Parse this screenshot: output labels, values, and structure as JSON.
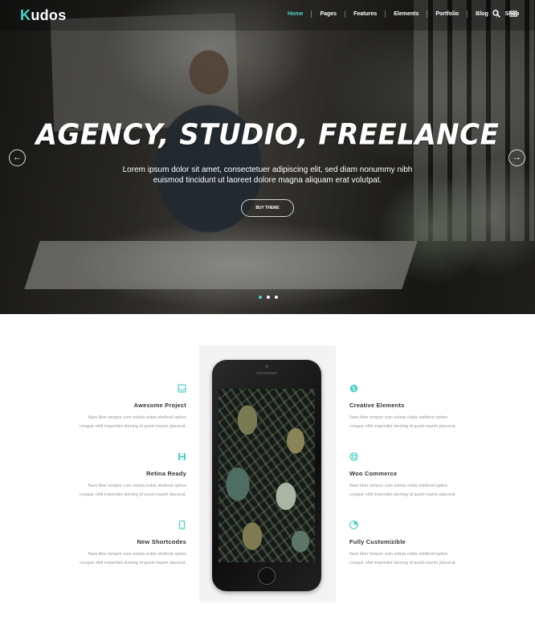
{
  "brand": {
    "logo_initial": "K",
    "logo_rest": "udos",
    "accent_color": "#4fd1c5"
  },
  "nav": {
    "items": [
      "Home",
      "Pages",
      "Features",
      "Elements",
      "Portfolio",
      "Blog",
      "Shop"
    ],
    "active_index": 0,
    "icons": [
      "search-icon",
      "menu-icon"
    ]
  },
  "hero": {
    "title": "AGENCY, STUDIO, FREELANCE",
    "subtitle": "Lorem ipsum dolor sit amet, consectetuer adipiscing elit, sed diam nonummy nibh euismod tincidunt ut laoreet dolore magna aliquam erat volutpat.",
    "button": "BUY THEME",
    "prev_arrow": "←",
    "next_arrow": "→",
    "slides": 3,
    "active_slide": 0
  },
  "features": {
    "left": [
      {
        "icon": "inbox-icon",
        "title": "Awesome Project",
        "text": "Nam liber tempor cum soluta nobis eleifend option congue nihil imperdiet doming id quod mazim placerat."
      },
      {
        "icon": "save-icon",
        "title": "Retina Ready",
        "text": "Nam liber tempor cum soluta nobis eleifend option congue nihil imperdiet doming id quod mazim placerat."
      },
      {
        "icon": "mobile-icon",
        "title": "New Shortcodes",
        "text": "Nam liber tempor cum soluta nobis eleifend option congue nihil imperdiet doming id quod mazim placerat."
      }
    ],
    "right": [
      {
        "icon": "globe-icon",
        "title": "Creative Elements",
        "text": "Nam liber tempor cum soluta nobis eleifend option congue nihil imperdiet doming id quod mazim placerat."
      },
      {
        "icon": "lifebuoy-icon",
        "title": "Woo Commerce",
        "text": "Nam liber tempor cum soluta nobis eleifend option congue nihil imperdiet doming id quod mazim placerat."
      },
      {
        "icon": "pie-chart-icon",
        "title": "Fully Customizible",
        "text": "Nam liber tempor cum soluta nobis eleifend option congue nihil imperdiet doming id quod mazim placerat."
      }
    ]
  }
}
